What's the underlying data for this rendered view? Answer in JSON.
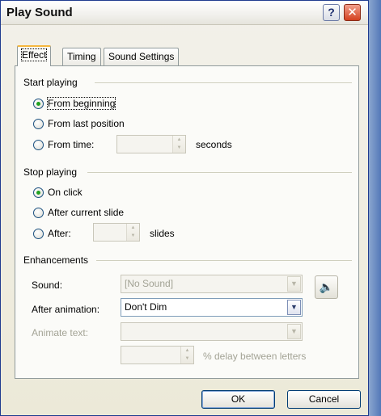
{
  "window": {
    "title": "Play Sound",
    "help_glyph": "?",
    "close_glyph": "✕"
  },
  "tabs": [
    {
      "label": "Effect",
      "active": true
    },
    {
      "label": "Timing",
      "active": false
    },
    {
      "label": "Sound Settings",
      "active": false
    }
  ],
  "start_playing": {
    "heading": "Start playing",
    "options": [
      {
        "label": "From beginning",
        "selected": true
      },
      {
        "label": "From last position",
        "selected": false
      },
      {
        "label": "From time:",
        "selected": false
      }
    ],
    "time_value": "",
    "time_unit": "seconds"
  },
  "stop_playing": {
    "heading": "Stop playing",
    "options": [
      {
        "label": "On click",
        "selected": true
      },
      {
        "label": "After current slide",
        "selected": false
      },
      {
        "label": "After:",
        "selected": false
      }
    ],
    "slides_value": "",
    "slides_unit": "slides"
  },
  "enhancements": {
    "heading": "Enhancements",
    "sound_label": "Sound:",
    "sound_value": "[No Sound]",
    "after_animation_label": "After animation:",
    "after_animation_value": "Don't Dim",
    "animate_text_label": "Animate text:",
    "animate_text_value": "",
    "delay_value": "",
    "delay_label": "% delay between letters"
  },
  "buttons": {
    "ok": "OK",
    "cancel": "Cancel"
  },
  "icons": {
    "help": "help-icon",
    "close": "close-icon",
    "speaker": "speaker-icon",
    "dropdown": "chevron-down-icon"
  },
  "colors": {
    "accent_tab": "#f6b73f",
    "radio_dot": "#21a121",
    "close_button": "#d3411f"
  }
}
